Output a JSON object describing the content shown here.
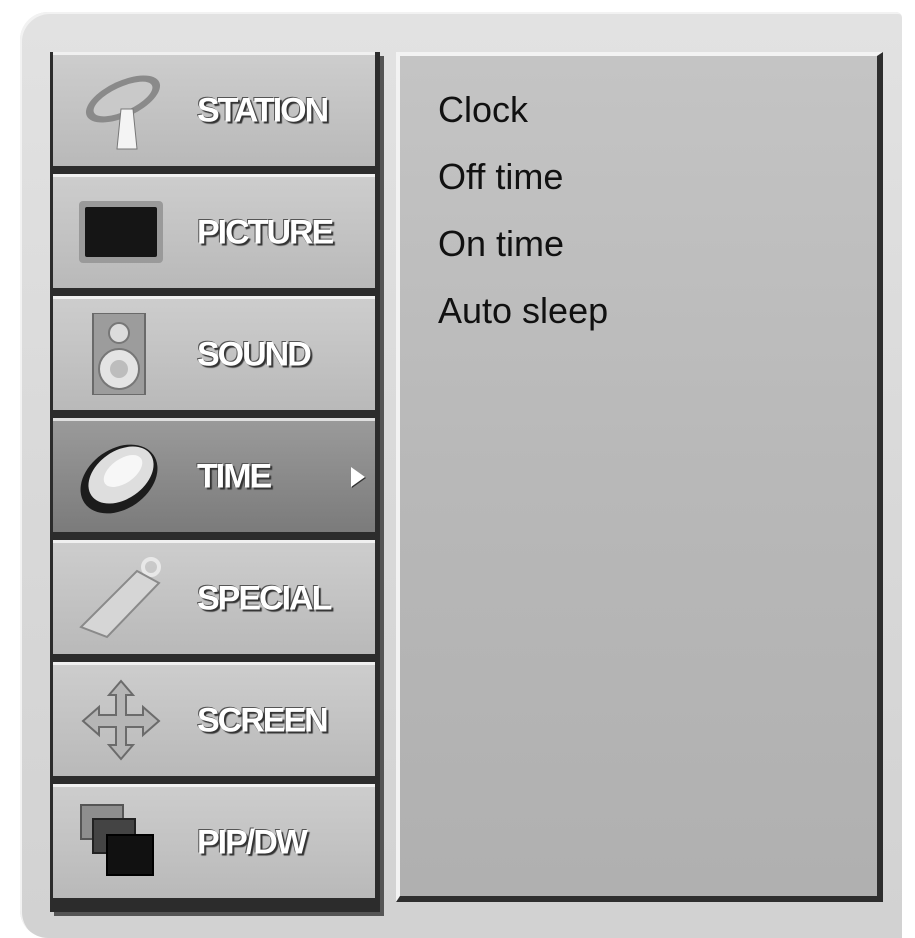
{
  "menu": {
    "items": [
      {
        "label": "STATION",
        "icon": "satellite-dish-icon",
        "active": false
      },
      {
        "label": "PICTURE",
        "icon": "tv-screen-icon",
        "active": false
      },
      {
        "label": "SOUND",
        "icon": "speaker-icon",
        "active": false
      },
      {
        "label": "TIME",
        "icon": "clock-icon",
        "active": true
      },
      {
        "label": "SPECIAL",
        "icon": "tag-icon",
        "active": false
      },
      {
        "label": "SCREEN",
        "icon": "move-arrows-icon",
        "active": false
      },
      {
        "label": "PIP/DW",
        "icon": "pip-windows-icon",
        "active": false
      }
    ]
  },
  "submenu": {
    "items": [
      "Clock",
      "Off time",
      "On time",
      "Auto sleep"
    ]
  }
}
